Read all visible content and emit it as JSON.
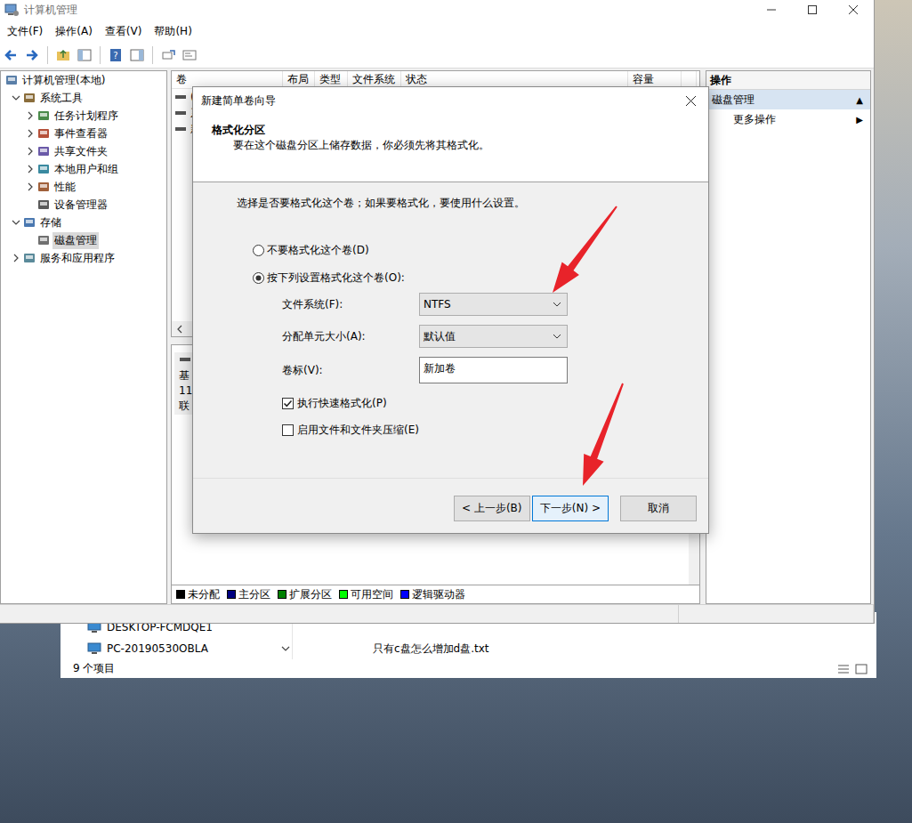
{
  "main_window": {
    "title": "计算机管理",
    "menu": [
      "文件(F)",
      "操作(A)",
      "查看(V)",
      "帮助(H)"
    ]
  },
  "tree": [
    {
      "label": "计算机管理(本地)",
      "level": 0,
      "expandable": false,
      "expanded": true,
      "selected": false
    },
    {
      "label": "系统工具",
      "level": 1,
      "expandable": true,
      "expanded": true,
      "selected": false
    },
    {
      "label": "任务计划程序",
      "level": 2,
      "expandable": true,
      "expanded": false,
      "selected": false
    },
    {
      "label": "事件查看器",
      "level": 2,
      "expandable": true,
      "expanded": false,
      "selected": false
    },
    {
      "label": "共享文件夹",
      "level": 2,
      "expandable": true,
      "expanded": false,
      "selected": false
    },
    {
      "label": "本地用户和组",
      "level": 2,
      "expandable": true,
      "expanded": false,
      "selected": false
    },
    {
      "label": "性能",
      "level": 2,
      "expandable": true,
      "expanded": false,
      "selected": false
    },
    {
      "label": "设备管理器",
      "level": 2,
      "expandable": false,
      "expanded": false,
      "selected": false
    },
    {
      "label": "存储",
      "level": 1,
      "expandable": true,
      "expanded": true,
      "selected": false
    },
    {
      "label": "磁盘管理",
      "level": 2,
      "expandable": false,
      "expanded": false,
      "selected": true
    },
    {
      "label": "服务和应用程序",
      "level": 1,
      "expandable": true,
      "expanded": false,
      "selected": false
    }
  ],
  "volume_table": {
    "columns": [
      "卷",
      "布局",
      "类型",
      "文件系统",
      "状态",
      "容量"
    ],
    "rows": [
      "(",
      "系",
      "新"
    ]
  },
  "disk_pane": {
    "lines": [
      "基",
      "11",
      "联"
    ]
  },
  "legend": [
    {
      "label": "未分配",
      "color": "#000000"
    },
    {
      "label": "主分区",
      "color": "#000080"
    },
    {
      "label": "扩展分区",
      "color": "#008000"
    },
    {
      "label": "可用空间",
      "color": "#00ff00"
    },
    {
      "label": "逻辑驱动器",
      "color": "#0000ff"
    }
  ],
  "actions": {
    "title": "操作",
    "section": "磁盘管理",
    "section_glyph": "▲",
    "items": [
      {
        "label": "更多操作",
        "glyph": "▶"
      }
    ]
  },
  "explorer": {
    "items": [
      "DESKTOP-FCMDQE1",
      "PC-20190530OBLA"
    ],
    "files": [
      "只有c盘怎么增加d盘.txt"
    ],
    "status": "9 个项目"
  },
  "dialog": {
    "title": "新建简单卷向导",
    "heading": "格式化分区",
    "subheading": "要在这个磁盘分区上储存数据，你必须先将其格式化。",
    "prompt": "选择是否要格式化这个卷；如果要格式化，要使用什么设置。",
    "options": [
      {
        "label": "不要格式化这个卷(D)",
        "selected": false
      },
      {
        "label": "按下列设置格式化这个卷(O):",
        "selected": true
      }
    ],
    "fields": [
      {
        "label": "文件系统(F):",
        "value": "NTFS",
        "kind": "select"
      },
      {
        "label": "分配单元大小(A):",
        "value": "默认值",
        "kind": "select"
      },
      {
        "label": "卷标(V):",
        "value": "新加卷",
        "kind": "text"
      }
    ],
    "checkboxes": [
      {
        "label": "执行快速格式化(P)",
        "checked": true
      },
      {
        "label": "启用文件和文件夹压缩(E)",
        "checked": false
      }
    ],
    "buttons": [
      {
        "label": "< 上一步(B)",
        "default": false
      },
      {
        "label": "下一步(N) >",
        "default": true
      },
      {
        "label": "取消",
        "default": false
      }
    ]
  }
}
